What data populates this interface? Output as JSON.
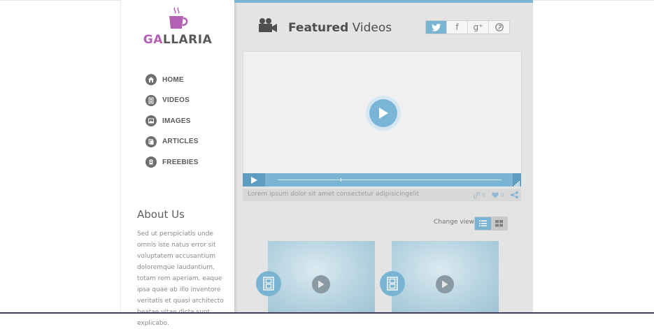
{
  "brand": {
    "logo_accent": "GA",
    "logo_rest": "LLARIA",
    "accent_color": "#b35fb4",
    "icon": "coffee-cup-icon"
  },
  "sidebar": {
    "nav": [
      {
        "label": "HOME",
        "icon": "home-icon"
      },
      {
        "label": "VIDEOS",
        "icon": "film-icon"
      },
      {
        "label": "IMAGES",
        "icon": "image-icon"
      },
      {
        "label": "ARTICLES",
        "icon": "articles-icon"
      },
      {
        "label": "FREEBIES",
        "icon": "freebies-icon"
      }
    ],
    "about": {
      "title": "About Us",
      "text": "Sed ut perspiciatis unde omnis iste natus error sit voluptatem accusantium doloremque laudantium, totam rem aperiam, eaque ipsa quae ab illo inventore veritatis et quasi architecto beatae vitae dicta sunt explicabo."
    }
  },
  "main": {
    "heading_strong": "Featured",
    "heading_rest": " Videos",
    "heading_icon": "video-camera-icon",
    "social": [
      {
        "icon": "twitter-icon",
        "glyph": ""
      },
      {
        "icon": "facebook-icon",
        "glyph": "f"
      },
      {
        "icon": "google-plus-icon",
        "glyph": "g⁺"
      },
      {
        "icon": "pinterest-icon",
        "glyph": ""
      }
    ],
    "player": {
      "caption": "Lorem ipsum dolor sit amet consectetur adipisicingelit",
      "links_count": "0",
      "likes_count": "0",
      "progress": 0.28,
      "accent_color": "#7ab4d3"
    },
    "change_view_label": "Change view :",
    "view_modes": [
      {
        "icon": "list-view-icon",
        "active": true
      },
      {
        "icon": "grid-view-icon",
        "active": false
      }
    ],
    "thumbnails": [
      {
        "icon": "film-icon"
      },
      {
        "icon": "film-icon"
      }
    ]
  }
}
